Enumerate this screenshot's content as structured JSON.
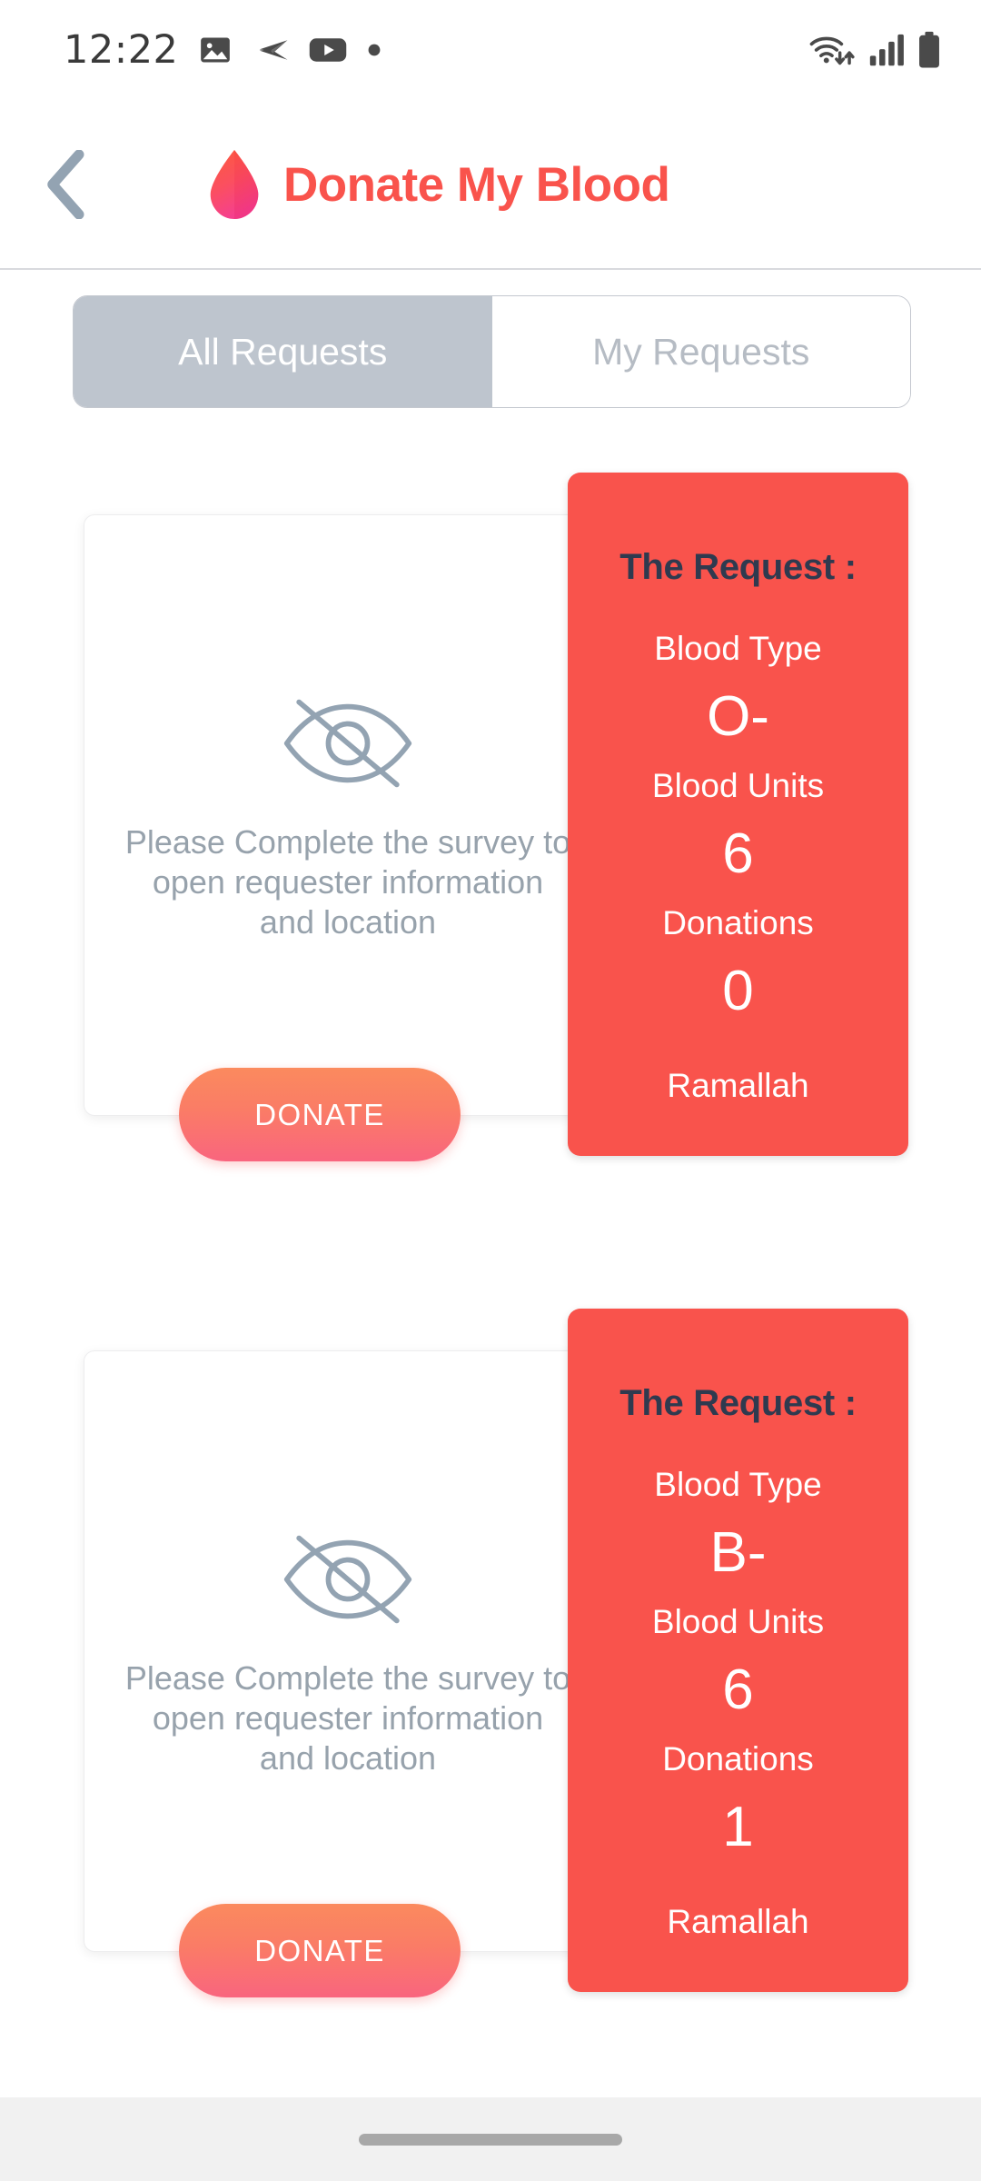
{
  "status_bar": {
    "time": "12:22",
    "left_icons": [
      "image-icon",
      "telegram-icon",
      "youtube-icon",
      "dot-icon"
    ],
    "right_icons": [
      "wifi-icon",
      "signal-icon",
      "battery-icon"
    ]
  },
  "app_bar": {
    "back_label": "back-chevron-icon",
    "logo": "blood-drop-icon",
    "title": "Donate My Blood",
    "title_color": "#F9534C"
  },
  "tabs": {
    "items": [
      {
        "label": "All Requests",
        "active": true
      },
      {
        "label": "My Requests",
        "active": false
      }
    ],
    "active_bg": "#BEC5CE",
    "inactive_bg": "#FFFFFF"
  },
  "cards": [
    {
      "privacy_icon": "eye-off-icon",
      "privacy_note": "Please Complete the survey to open requester information and location",
      "donate_label": "DONATE",
      "request": {
        "heading": "The Request :",
        "blood_type_label": "Blood Type",
        "blood_type_value": "O-",
        "blood_units_label": "Blood Units",
        "blood_units_value": "6",
        "donations_label": "Donations",
        "donations_value": "0",
        "city": "Ramallah",
        "panel_color": "#F9534C"
      }
    },
    {
      "privacy_icon": "eye-off-icon",
      "privacy_note": "Please Complete the survey to open requester information and location",
      "donate_label": "DONATE",
      "request": {
        "heading": "The Request :",
        "blood_type_label": "Blood Type",
        "blood_type_value": "B-",
        "blood_units_label": "Blood Units",
        "blood_units_value": "6",
        "donations_label": "Donations",
        "donations_value": "1",
        "city": "Ramallah",
        "panel_color": "#F9534C"
      }
    }
  ],
  "nav_bar": {
    "handle": "gesture-home-handle"
  }
}
